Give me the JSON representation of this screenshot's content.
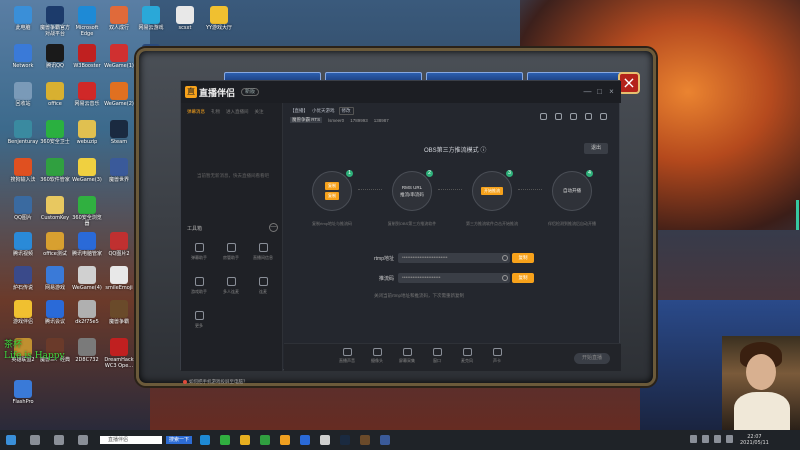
{
  "desktop": {
    "icons": [
      {
        "label": "此电脑",
        "color": "#3a8fd8"
      },
      {
        "label": "魔兽争霸官方对战平台",
        "color": "#1c3b6b"
      },
      {
        "label": "Microsoft Edge",
        "color": "#1e8ad6"
      },
      {
        "label": "双人成行",
        "color": "#e06a3a"
      },
      {
        "label": "网易云游戏",
        "color": "#2aa8d8"
      },
      {
        "label": "scsxt",
        "color": "#e8e8e8"
      },
      {
        "label": "YY游戏大厅",
        "color": "#f0c030"
      },
      {
        "label": "Network",
        "color": "#3a7ad8"
      },
      {
        "label": "腾讯QQ",
        "color": "#1a1a1a"
      },
      {
        "label": "W3Booster",
        "color": "#c02020"
      },
      {
        "label": "WeGame(1)",
        "color": "#d03030"
      },
      {
        "label": "英雄联盟",
        "color": "#2a4a7a"
      },
      {
        "label": "回收站",
        "color": "#7a9ab8"
      },
      {
        "label": "office",
        "color": "#d8b030"
      },
      {
        "label": "网易云音乐",
        "color": "#d02828"
      },
      {
        "label": "WeGame(2)",
        "color": "#e07020"
      },
      {
        "label": "Benjenturay",
        "color": "#3a8aa0"
      },
      {
        "label": "360安全卫士",
        "color": "#2ab040"
      },
      {
        "label": "webuzip",
        "color": "#e0c050"
      },
      {
        "label": "Steam",
        "color": "#1a2a40"
      },
      {
        "label": "搜狗输入法",
        "color": "#e05020"
      },
      {
        "label": "360软件管家",
        "color": "#30a040"
      },
      {
        "label": "WeGame(3)",
        "color": "#f0d040"
      },
      {
        "label": "魔兽世界",
        "color": "#3a5a9a"
      },
      {
        "label": "QQ图片",
        "color": "#3a6aa0"
      },
      {
        "label": "CustomKey",
        "color": "#e8c860"
      },
      {
        "label": "360安全浏览器",
        "color": "#30b040"
      },
      {
        "label": "腾讯视频",
        "color": "#2a8ad8"
      },
      {
        "label": "office测试",
        "color": "#d8a030"
      },
      {
        "label": "腾讯电脑管家",
        "color": "#2a6ad8"
      },
      {
        "label": "QQ图片2",
        "color": "#c03030"
      },
      {
        "label": "炉石传说",
        "color": "#3a4a8a"
      },
      {
        "label": "网易游戏",
        "color": "#3a7ad8"
      },
      {
        "label": "WeGame(4)",
        "color": "#d0d0d0"
      },
      {
        "label": "smileEmoji",
        "color": "#e8e8e8"
      },
      {
        "label": "游戏伴侣",
        "color": "#f0c030"
      },
      {
        "label": "腾讯会议",
        "color": "#2a6ad8"
      },
      {
        "label": "dk2f75e5",
        "color": "#b0b0b0"
      },
      {
        "label": "魔兽争霸",
        "color": "#6a4a2a"
      },
      {
        "label": "英雄联盟2",
        "color": "#c09030"
      },
      {
        "label": "魔兽三：经典",
        "color": "#6a3a2a"
      },
      {
        "label": "2D8C732",
        "color": "#7a7a7a"
      },
      {
        "label": "DreamHack WC3 Ope...",
        "color": "#c02020"
      },
      {
        "label": "FlashPro",
        "color": "#3a7ad8"
      }
    ]
  },
  "overlay_text": {
    "line1": "茶杯",
    "line2": "Life is Happy"
  },
  "game_close": "×",
  "app": {
    "logo_mark": "直",
    "logo_text": "直播伴侣",
    "badge": "新版",
    "window_controls": [
      "—",
      "□",
      "×"
    ],
    "sidebar": {
      "tabs": [
        "弹幕消息",
        "礼物",
        "进入直播间",
        "关注"
      ],
      "empty_message": "当前暂无新消息，快去直播间看看吧",
      "tools_label": "工具箱",
      "tools_toggle": "—",
      "tools": [
        "弹幕助手",
        "房管助手",
        "直播间信息",
        "游戏助手",
        "多人连麦",
        "连麦",
        "更多"
      ],
      "footer": "如何把手机游戏投屏至电脑？"
    },
    "room": {
      "tag": "【直播】",
      "name": "小优天游戏",
      "edit_label": "修改",
      "category": "魔兽争霸 RTS",
      "user": "lsmeer0",
      "id": "1789993",
      "fans": "138987"
    },
    "mode_title": "OBS第三方推流模式 ⓘ",
    "exit_button": "退出",
    "steps": [
      {
        "num": "1",
        "btn1": "复制",
        "btn2": "复制",
        "caption": "复制rtmp地址与推流码"
      },
      {
        "num": "2",
        "line1": "RMS URL",
        "line2": "推流/串流码",
        "caption": "复制到OBS第三方推流软件"
      },
      {
        "num": "3",
        "btn1": "开始推流",
        "caption": "第三方推流软件点击开始推流"
      },
      {
        "num": "4",
        "line1": "自动开播",
        "caption": "伴侣检测到推流后自动开播"
      }
    ],
    "fields": [
      {
        "label": "rtmp地址",
        "value": "••••••••••••••••••••••••••",
        "button": "复制"
      },
      {
        "label": "推流码",
        "value": "••••••••••••••••••••••",
        "button": "复制"
      }
    ],
    "hint": "关闭当前rtmp地址和推流码，下次需重新复制",
    "bottom_bar": [
      "直播声音",
      "摄像头",
      "屏幕采集",
      "窗口",
      "麦克风",
      "声卡"
    ],
    "start_button": "开始直播"
  },
  "taskbar": {
    "search_text": "直播伴侣",
    "search_button": "搜索一下",
    "time": "22:07",
    "date": "2021/05/11"
  }
}
